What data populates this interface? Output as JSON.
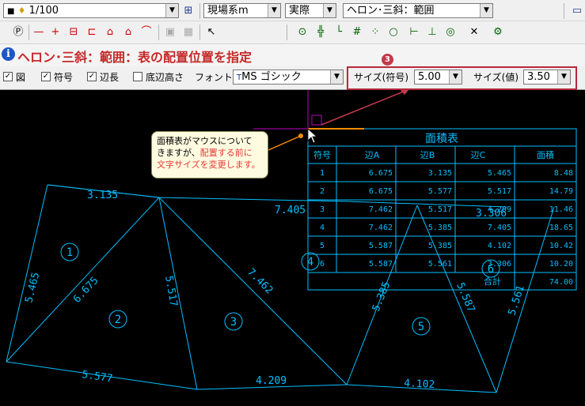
{
  "toolbar1": {
    "layer_combo": "1/100",
    "coord_combo": "現場系m",
    "mode_combo": "実際",
    "command_combo": "ヘロン･三斜：範囲"
  },
  "title": {
    "text": "ヘロン･三斜：範囲：表の配置位置を指定"
  },
  "options": {
    "fig_label": "図",
    "symbol_label": "符号",
    "side_label": "辺長",
    "base_height_label": "底辺高さ",
    "font_label": "フォント",
    "font_value": "MS ゴシック",
    "size_symbol_label": "サイズ(符号)",
    "size_symbol_value": "5.00",
    "size_value_label": "サイズ(値)",
    "size_value_value": "3.50"
  },
  "marker": "3",
  "callout": {
    "line1": "面積表がマウスについて",
    "line2a": "きますが、",
    "line2b": "配置する前に",
    "line3": "文字サイズを変更します。"
  },
  "table": {
    "title": "面積表",
    "headers": [
      "符号",
      "辺A",
      "辺B",
      "辺C",
      "面積"
    ],
    "rows": [
      [
        "1",
        "6.675",
        "3.135",
        "5.465",
        "8.48"
      ],
      [
        "2",
        "6.675",
        "5.577",
        "5.517",
        "14.79"
      ],
      [
        "3",
        "7.462",
        "5.517",
        "4.209",
        "11.46"
      ],
      [
        "4",
        "7.462",
        "5.385",
        "7.405",
        "18.65"
      ],
      [
        "5",
        "5.587",
        "5.385",
        "4.102",
        "10.42"
      ],
      [
        "6",
        "5.587",
        "5.561",
        "3.306",
        "10.20"
      ]
    ],
    "total_label": "合計",
    "total_value": "74.00"
  },
  "drawing": {
    "lengths": [
      "3.135",
      "7.405",
      "5.465",
      "6.675",
      "5.517",
      "7.462",
      "5.385",
      "5.587",
      "5.561",
      "3.306",
      "5.577",
      "4.209",
      "4.102"
    ],
    "regions": [
      "1",
      "2",
      "3",
      "4",
      "5",
      "6"
    ]
  },
  "colors": {
    "cad_line": "#00bfff",
    "accent": "#b52a3a",
    "title_red": "#c62828",
    "cursor_crosshair": "#c000c0"
  }
}
